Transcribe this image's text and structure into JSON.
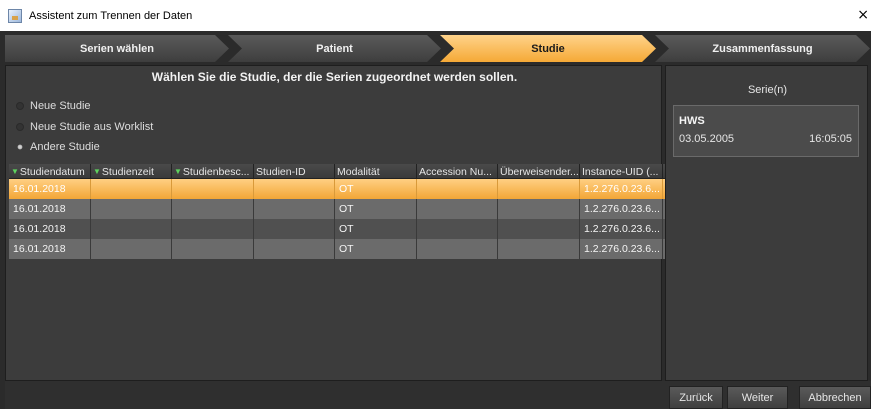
{
  "window": {
    "title": "Assistent zum Trennen der Daten",
    "close_glyph": "×"
  },
  "steps": [
    {
      "label": "Serien wählen",
      "active": false
    },
    {
      "label": "Patient",
      "active": false
    },
    {
      "label": "Studie",
      "active": true
    },
    {
      "label": "Zusammenfassung",
      "active": false
    }
  ],
  "main": {
    "heading": "Wählen Sie die Studie, der die Serien zugeordnet werden sollen.",
    "options": [
      {
        "label": "Neue Studie",
        "selected": false
      },
      {
        "label": "Neue Studie aus Worklist",
        "selected": false
      },
      {
        "label": "Andere Studie",
        "selected": true
      }
    ],
    "table": {
      "columns": [
        {
          "label": "Studiendatum",
          "filter": true
        },
        {
          "label": "Studienzeit",
          "filter": true
        },
        {
          "label": "Studienbesc...",
          "filter": true
        },
        {
          "label": "Studien-ID",
          "filter": false
        },
        {
          "label": "Modalität",
          "filter": false
        },
        {
          "label": "Accession Nu...",
          "filter": false
        },
        {
          "label": "Überweisender...",
          "filter": false
        },
        {
          "label": "Instance-UID (...",
          "filter": false
        }
      ],
      "filter_glyph": "▼",
      "rows": [
        {
          "cells": [
            "16.01.2018",
            "",
            "",
            "",
            "OT",
            "",
            "",
            "1.2.276.0.23.6..."
          ],
          "selected": true
        },
        {
          "cells": [
            "16.01.2018",
            "",
            "",
            "",
            "OT",
            "",
            "",
            "1.2.276.0.23.6..."
          ],
          "selected": false
        },
        {
          "cells": [
            "16.01.2018",
            "",
            "",
            "",
            "OT",
            "",
            "",
            "1.2.276.0.23.6..."
          ],
          "selected": false
        },
        {
          "cells": [
            "16.01.2018",
            "",
            "",
            "",
            "OT",
            "",
            "",
            "1.2.276.0.23.6..."
          ],
          "selected": false
        }
      ]
    }
  },
  "side": {
    "title": "Serie(n)",
    "series": {
      "name": "HWS",
      "date": "03.05.2005",
      "time": "16:05:05"
    }
  },
  "buttons": {
    "back": "Zurück",
    "next": "Weiter",
    "cancel": "Abbrechen"
  },
  "colors": {
    "accent": "#f5a936",
    "panel": "#3c3c3c",
    "row_alt": "#6b6b6b",
    "row": "#505050"
  },
  "icons": {
    "app": "java-app-icon",
    "filter": "green-filter-triangle-icon"
  }
}
